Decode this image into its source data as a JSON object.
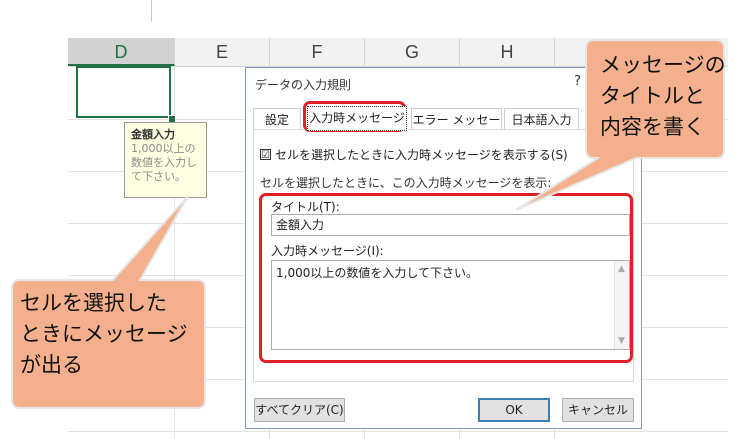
{
  "spreadsheet": {
    "columns": [
      "D",
      "E",
      "F",
      "G",
      "H"
    ],
    "selected_column": "D"
  },
  "tooltip": {
    "title": "金額入力",
    "body": "1,000以上の\n数値を入力し\nて下さい。"
  },
  "dialog": {
    "title": "データの入力規則",
    "help": "?",
    "tabs": [
      {
        "label": "設定"
      },
      {
        "label": "入力時メッセージ"
      },
      {
        "label": "エラー メッセージ"
      },
      {
        "label": "日本語入力"
      }
    ],
    "active_tab": "入力時メッセージ",
    "show_message_checkbox": {
      "label": "セルを選択したときに入力時メッセージを表示する(S)",
      "checked": "☑"
    },
    "group_label": "セルを選択したときに、この入力時メッセージを表示:",
    "title_field_label": "タイトル(T):",
    "title_value": "金額入力",
    "message_field_label": "入力時メッセージ(I):",
    "message_value": "1,000以上の数値を入力して下さい。",
    "clear_button": "すべてクリア(C)",
    "ok_button": "OK",
    "cancel_button": "キャンセル"
  },
  "callouts": {
    "top_right": "メッセージの\nタイトルと\n内容を書く",
    "bottom_left": "セルを選択した\nときにメッセージ\nが出る"
  },
  "colors": {
    "callout_fill": "#f4b08c",
    "callout_stroke": "#e0e0e0",
    "highlight_red": "#e21f26",
    "excel_green": "#217346"
  }
}
